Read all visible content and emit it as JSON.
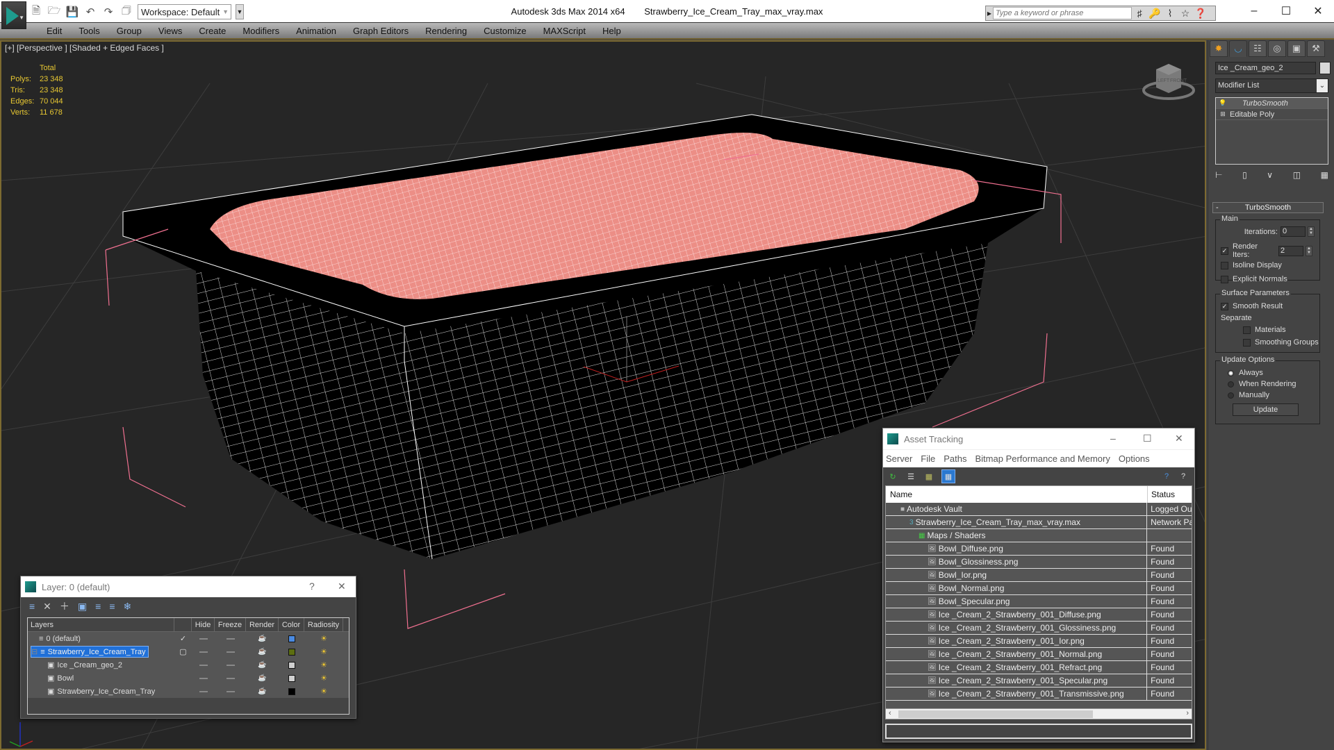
{
  "titlebar": {
    "app_title": "Autodesk 3ds Max  2014 x64",
    "file_name": "Strawberry_Ice_Cream_Tray_max_vray.max",
    "workspace": "Workspace: Default",
    "search_placeholder": "Type a keyword or phrase",
    "minimize": "–",
    "maximize": "☐",
    "close": "✕"
  },
  "menu": [
    "Edit",
    "Tools",
    "Group",
    "Views",
    "Create",
    "Modifiers",
    "Animation",
    "Graph Editors",
    "Rendering",
    "Customize",
    "MAXScript",
    "Help"
  ],
  "viewport": {
    "label": "[+] [Perspective ] [Shaded + Edged Faces ]",
    "stats": {
      "header": "Total",
      "rows": [
        {
          "k": "Polys:",
          "v": "23 348"
        },
        {
          "k": "Tris:",
          "v": "23 348"
        },
        {
          "k": "Edges:",
          "v": "70 044"
        },
        {
          "k": "Verts:",
          "v": "11 678"
        }
      ]
    },
    "viewcube_faces": [
      "LEFT",
      "FRONT"
    ],
    "gizmo_axes": [
      "x",
      "y",
      "z"
    ]
  },
  "command_panel": {
    "object_name": "Ice _Cream_geo_2",
    "object_color": "#d8d8d8",
    "modifier_list": "Modifier List",
    "stack": [
      {
        "label": "TurboSmooth",
        "selected": true
      },
      {
        "label": "Editable Poly",
        "selected": false
      }
    ],
    "rollout": {
      "title": "TurboSmooth",
      "main_group": "Main",
      "iterations_label": "Iterations:",
      "iterations_value": "0",
      "render_iters_label": "Render Iters:",
      "render_iters_value": "2",
      "render_iters_checked": true,
      "isoline_display": "Isoline Display",
      "explicit_normals": "Explicit Normals",
      "surface_group": "Surface Parameters",
      "smooth_result": "Smooth Result",
      "separate": "Separate",
      "materials": "Materials",
      "smoothing_groups": "Smoothing Groups",
      "update_group": "Update Options",
      "always": "Always",
      "when_rendering": "When Rendering",
      "manually": "Manually",
      "update_button": "Update"
    }
  },
  "layer_dialog": {
    "title": "Layer: 0 (default)",
    "help": "?",
    "close": "✕",
    "columns": [
      "Layers",
      "",
      "Hide",
      "Freeze",
      "Render",
      "Color",
      "Radiosity"
    ],
    "rows": [
      {
        "name": "0 (default)",
        "indent": 1,
        "active": "✓",
        "color": "#4a8ae0",
        "selected": false,
        "type": "layer"
      },
      {
        "name": "Strawberry_Ice_Cream_Tray",
        "indent": 0,
        "active": "▢",
        "color": "#5c6e10",
        "selected": true,
        "type": "layer"
      },
      {
        "name": "Ice _Cream_geo_2",
        "indent": 2,
        "active": "",
        "color": "#d0d0d0",
        "selected": false,
        "type": "object"
      },
      {
        "name": "Bowl",
        "indent": 2,
        "active": "",
        "color": "#d0d0d0",
        "selected": false,
        "type": "object"
      },
      {
        "name": "Strawberry_Ice_Cream_Tray",
        "indent": 2,
        "active": "",
        "color": "#000000",
        "selected": false,
        "type": "object"
      }
    ]
  },
  "asset_dialog": {
    "title": "Asset Tracking",
    "menu": [
      "Server",
      "File",
      "Paths",
      "Bitmap Performance and Memory",
      "Options"
    ],
    "columns": [
      "Name",
      "Status"
    ],
    "rows": [
      {
        "name": "Autodesk Vault",
        "status": "Logged Ou",
        "indent": 1,
        "icon": "vault"
      },
      {
        "name": "Strawberry_Ice_Cream_Tray_max_vray.max",
        "status": "Network Pa",
        "indent": 2,
        "icon": "max"
      },
      {
        "name": "Maps / Shaders",
        "status": "",
        "indent": 3,
        "icon": "maps"
      },
      {
        "name": "Bowl_Diffuse.png",
        "status": "Found",
        "indent": 4,
        "icon": "image"
      },
      {
        "name": "Bowl_Glossiness.png",
        "status": "Found",
        "indent": 4,
        "icon": "image"
      },
      {
        "name": "Bowl_Ior.png",
        "status": "Found",
        "indent": 4,
        "icon": "image"
      },
      {
        "name": "Bowl_Normal.png",
        "status": "Found",
        "indent": 4,
        "icon": "image"
      },
      {
        "name": "Bowl_Specular.png",
        "status": "Found",
        "indent": 4,
        "icon": "image"
      },
      {
        "name": "Ice _Cream_2_Strawberry_001_Diffuse.png",
        "status": "Found",
        "indent": 4,
        "icon": "image"
      },
      {
        "name": "Ice _Cream_2_Strawberry_001_Glossiness.png",
        "status": "Found",
        "indent": 4,
        "icon": "image"
      },
      {
        "name": "Ice _Cream_2_Strawberry_001_Ior.png",
        "status": "Found",
        "indent": 4,
        "icon": "image"
      },
      {
        "name": "Ice _Cream_2_Strawberry_001_Normal.png",
        "status": "Found",
        "indent": 4,
        "icon": "image"
      },
      {
        "name": "Ice _Cream_2_Strawberry_001_Refract.png",
        "status": "Found",
        "indent": 4,
        "icon": "image"
      },
      {
        "name": "Ice _Cream_2_Strawberry_001_Specular.png",
        "status": "Found",
        "indent": 4,
        "icon": "image"
      },
      {
        "name": "Ice _Cream_2_Strawberry_001_Transmissive.png",
        "status": "Found",
        "indent": 4,
        "icon": "image"
      }
    ]
  }
}
